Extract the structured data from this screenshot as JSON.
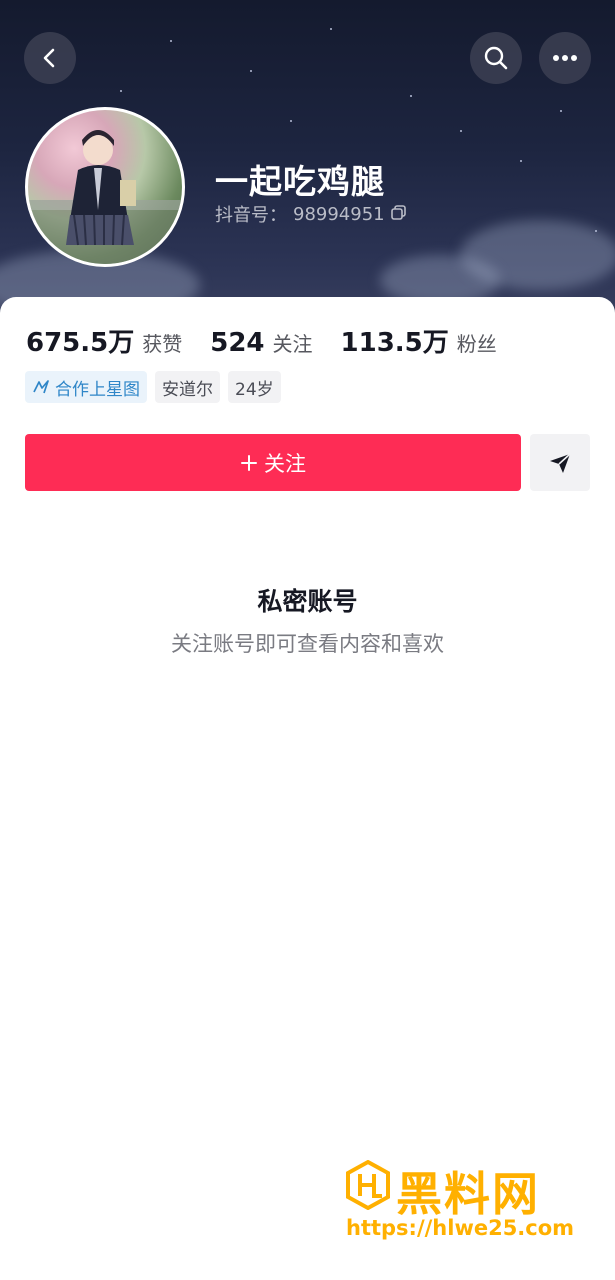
{
  "profile": {
    "nickname": "一起吃鸡腿",
    "douyin_id_label": "抖音号：",
    "douyin_id": "98994951"
  },
  "stats": [
    {
      "value": "675.5万",
      "label": "获赞"
    },
    {
      "value": "524",
      "label": "关注"
    },
    {
      "value": "113.5万",
      "label": "粉丝"
    }
  ],
  "tags": {
    "star": "合作上星图",
    "location": "安道尔",
    "age": "24岁"
  },
  "actions": {
    "follow": "关注"
  },
  "private": {
    "title": "私密账号",
    "subtitle": "关注账号即可查看内容和喜欢"
  },
  "watermark": {
    "name": "黑料网",
    "url": "https://hlwe25.com"
  },
  "icons": {
    "back": "back-icon",
    "search": "search-icon",
    "more": "more-icon",
    "copy": "copy-icon",
    "share": "send-icon",
    "star": "star-map-icon"
  },
  "colors": {
    "accent": "#fe2c55",
    "star_tag": "#2f86c8",
    "watermark": "#ffb000"
  }
}
